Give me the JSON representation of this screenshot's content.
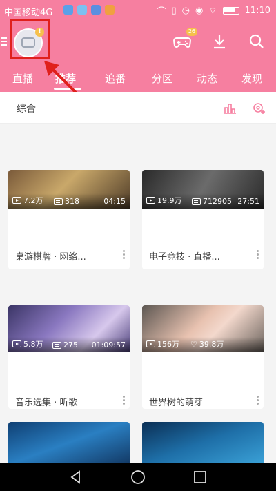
{
  "status_bar": {
    "carrier": "中国移动4G",
    "time": "11:10"
  },
  "header": {
    "avatar_badge": "!",
    "game_badge": "26",
    "tabs": [
      "直播",
      "推荐",
      "追番",
      "分区",
      "动态",
      "发现"
    ],
    "active_tab": "推荐"
  },
  "section": {
    "label": "综合"
  },
  "cards": [
    {
      "plays": "7.2万",
      "danmaku": "318",
      "duration": "04:15",
      "title": "桌游棋牌 · 网络..."
    },
    {
      "plays": "19.9万",
      "danmaku": "712905",
      "duration": "27:51",
      "title": "电子竞技 · 直播..."
    },
    {
      "plays": "5.8万",
      "danmaku": "275",
      "duration": "01:09:57",
      "title": "音乐选集 · 听歌"
    },
    {
      "plays": "156万",
      "likes": "39.8万",
      "title": "世界树的萌芽"
    }
  ],
  "colors": {
    "brand_pink": "#f67fa0",
    "annotation_red": "#e0201c",
    "badge_yellow": "#f6c04c"
  },
  "icons": [
    "menu-icon",
    "avatar-icon",
    "game-icon",
    "download-icon",
    "search-icon",
    "ranking-icon",
    "channel-settings-icon",
    "play-icon",
    "danmaku-icon",
    "like-icon",
    "more-icon",
    "back-icon",
    "home-icon",
    "recents-icon"
  ]
}
